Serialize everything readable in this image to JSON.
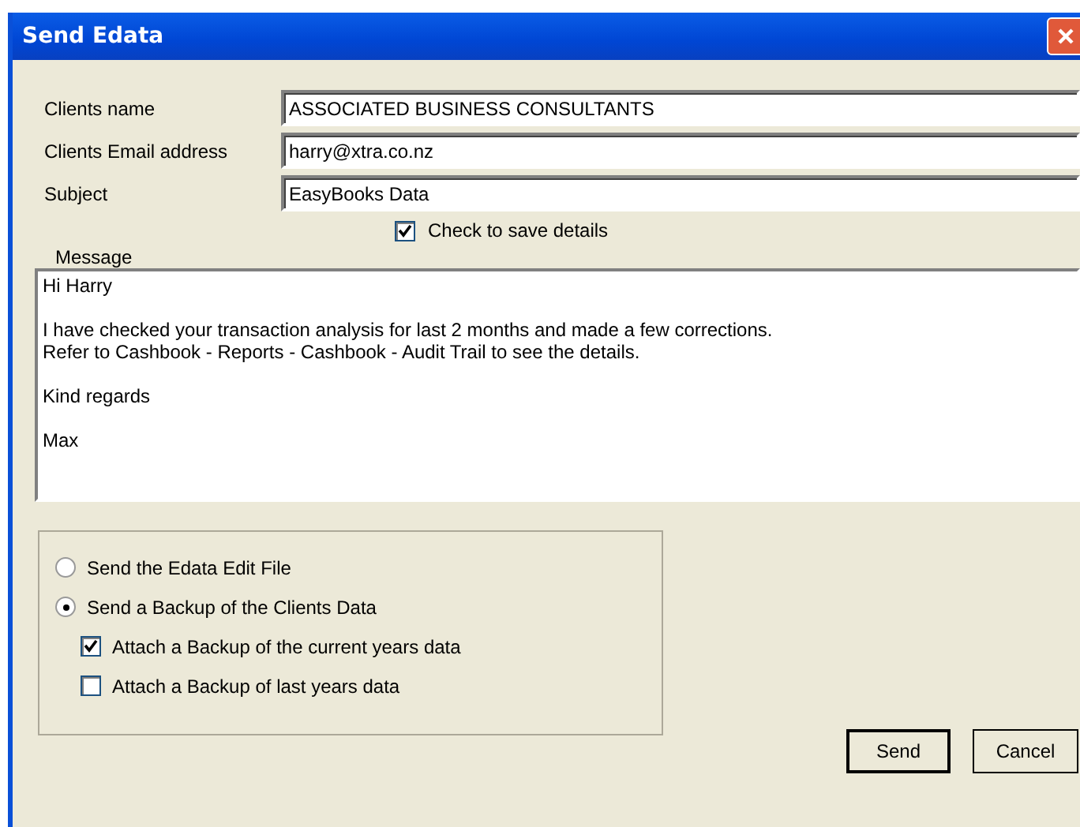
{
  "window": {
    "title": "Send Edata"
  },
  "fields": [
    {
      "label": "Clients name",
      "value": "ASSOCIATED BUSINESS CONSULTANTS"
    },
    {
      "label": "Clients Email address",
      "value": "harry@xtra.co.nz"
    },
    {
      "label": "Subject",
      "value": "EasyBooks Data"
    }
  ],
  "save_details": {
    "label": "Check to save details",
    "checked": true
  },
  "message": {
    "label": "Message",
    "paragraphs": [
      [
        "Hi Harry"
      ],
      [
        "I have checked your transaction analysis for last 2 months and made a few corrections.",
        "Refer to Cashbook - Reports - Cashbook - Audit Trail to see the details."
      ],
      [
        "Kind regards"
      ],
      [
        "Max"
      ]
    ]
  },
  "options": [
    {
      "kind": "radio",
      "label": "Send the Edata Edit File",
      "selected": false
    },
    {
      "kind": "radio",
      "label": "Send a Backup of the Clients Data",
      "selected": true
    },
    {
      "kind": "checkbox",
      "label": "Attach a Backup of the current years data",
      "checked": true
    },
    {
      "kind": "checkbox",
      "label": "Attach a Backup of last years data",
      "checked": false
    }
  ],
  "buttons": [
    {
      "label": "Send",
      "default": true
    },
    {
      "label": "Cancel",
      "default": false
    }
  ]
}
